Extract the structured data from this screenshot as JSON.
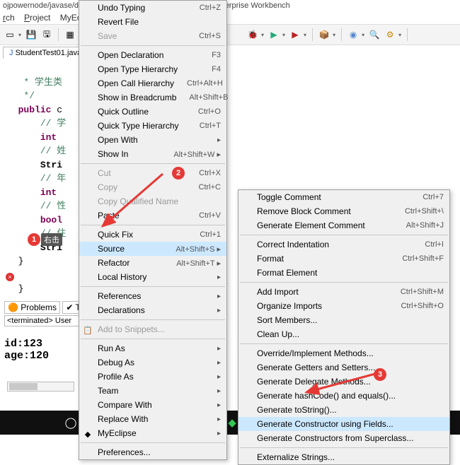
{
  "title": "ojpowernode/javase/day09/test001/Student.java - MyEclipse Enterprise Workbench",
  "menubar": [
    "rch",
    "Project",
    "MyEcl"
  ],
  "tab": "StudentTest01.java",
  "code": {
    "l1": "* 学生类",
    "l2": "*/",
    "l3_kw": "public",
    "l3": " c",
    "l4": "// 学",
    "l5_kw": "int",
    "l6": "// 姓",
    "l7": "Stri",
    "l8": "// 年",
    "l9_kw": "int",
    "l10": "// 性",
    "l11_kw": "bool",
    "l12": "// 住",
    "l13": "Stri",
    "l14": "}",
    "l15": "}"
  },
  "menu1": [
    {
      "label": "Undo Typing",
      "sc": "Ctrl+Z"
    },
    {
      "label": "Revert File"
    },
    {
      "label": "Save",
      "sc": "Ctrl+S",
      "disabled": true
    },
    {
      "sep": true
    },
    {
      "label": "Open Declaration",
      "sc": "F3"
    },
    {
      "label": "Open Type Hierarchy",
      "sc": "F4"
    },
    {
      "label": "Open Call Hierarchy",
      "sc": "Ctrl+Alt+H"
    },
    {
      "label": "Show in Breadcrumb",
      "sc": "Alt+Shift+B"
    },
    {
      "label": "Quick Outline",
      "sc": "Ctrl+O"
    },
    {
      "label": "Quick Type Hierarchy",
      "sc": "Ctrl+T"
    },
    {
      "label": "Open With",
      "sub": true
    },
    {
      "label": "Show In",
      "sc": "Alt+Shift+W ▸",
      "sub": false
    },
    {
      "sep": true
    },
    {
      "label": "Cut",
      "sc": "Ctrl+X",
      "disabled": true
    },
    {
      "label": "Copy",
      "sc": "Ctrl+C",
      "disabled": true
    },
    {
      "label": "Copy Qualified Name",
      "disabled": true
    },
    {
      "label": "Paste",
      "sc": "Ctrl+V"
    },
    {
      "sep": true
    },
    {
      "label": "Quick Fix",
      "sc": "Ctrl+1"
    },
    {
      "label": "Source",
      "sc": "Alt+Shift+S ▸",
      "hl": true
    },
    {
      "label": "Refactor",
      "sc": "Alt+Shift+T ▸"
    },
    {
      "label": "Local History",
      "sub": true
    },
    {
      "sep": true
    },
    {
      "label": "References",
      "sub": true
    },
    {
      "label": "Declarations",
      "sub": true
    },
    {
      "sep": true
    },
    {
      "label": "Add to Snippets...",
      "disabled": true,
      "icon": "📋"
    },
    {
      "sep": true
    },
    {
      "label": "Run As",
      "sub": true
    },
    {
      "label": "Debug As",
      "sub": true
    },
    {
      "label": "Profile As",
      "sub": true
    },
    {
      "label": "Team",
      "sub": true
    },
    {
      "label": "Compare With",
      "sub": true
    },
    {
      "label": "Replace With",
      "sub": true
    },
    {
      "label": "MyEclipse",
      "sub": true,
      "icon": "◆"
    },
    {
      "sep": true
    },
    {
      "label": "Preferences..."
    }
  ],
  "menu2": [
    {
      "label": "Toggle Comment",
      "sc": "Ctrl+7"
    },
    {
      "label": "Remove Block Comment",
      "sc": "Ctrl+Shift+\\"
    },
    {
      "label": "Generate Element Comment",
      "sc": "Alt+Shift+J"
    },
    {
      "sep": true
    },
    {
      "label": "Correct Indentation",
      "sc": "Ctrl+I"
    },
    {
      "label": "Format",
      "sc": "Ctrl+Shift+F"
    },
    {
      "label": "Format Element"
    },
    {
      "sep": true
    },
    {
      "label": "Add Import",
      "sc": "Ctrl+Shift+M"
    },
    {
      "label": "Organize Imports",
      "sc": "Ctrl+Shift+O"
    },
    {
      "label": "Sort Members..."
    },
    {
      "label": "Clean Up..."
    },
    {
      "sep": true
    },
    {
      "label": "Override/Implement Methods..."
    },
    {
      "label": "Generate Getters and Setters..."
    },
    {
      "label": "Generate Delegate Methods..."
    },
    {
      "label": "Generate hashCode() and equals()..."
    },
    {
      "label": "Generate toString()..."
    },
    {
      "label": "Generate Constructor using Fields...",
      "hl": true
    },
    {
      "label": "Generate Constructors from Superclass..."
    },
    {
      "sep": true
    },
    {
      "label": "Externalize Strings..."
    }
  ],
  "bottom": {
    "tab1": "Problems",
    "tab2": "Ta",
    "terminated": "<terminated> User",
    "out1": "id:123",
    "out2": "age:120"
  },
  "anno": {
    "a1": "1",
    "a1_label": "右击",
    "a2": "2",
    "a3": "3"
  }
}
